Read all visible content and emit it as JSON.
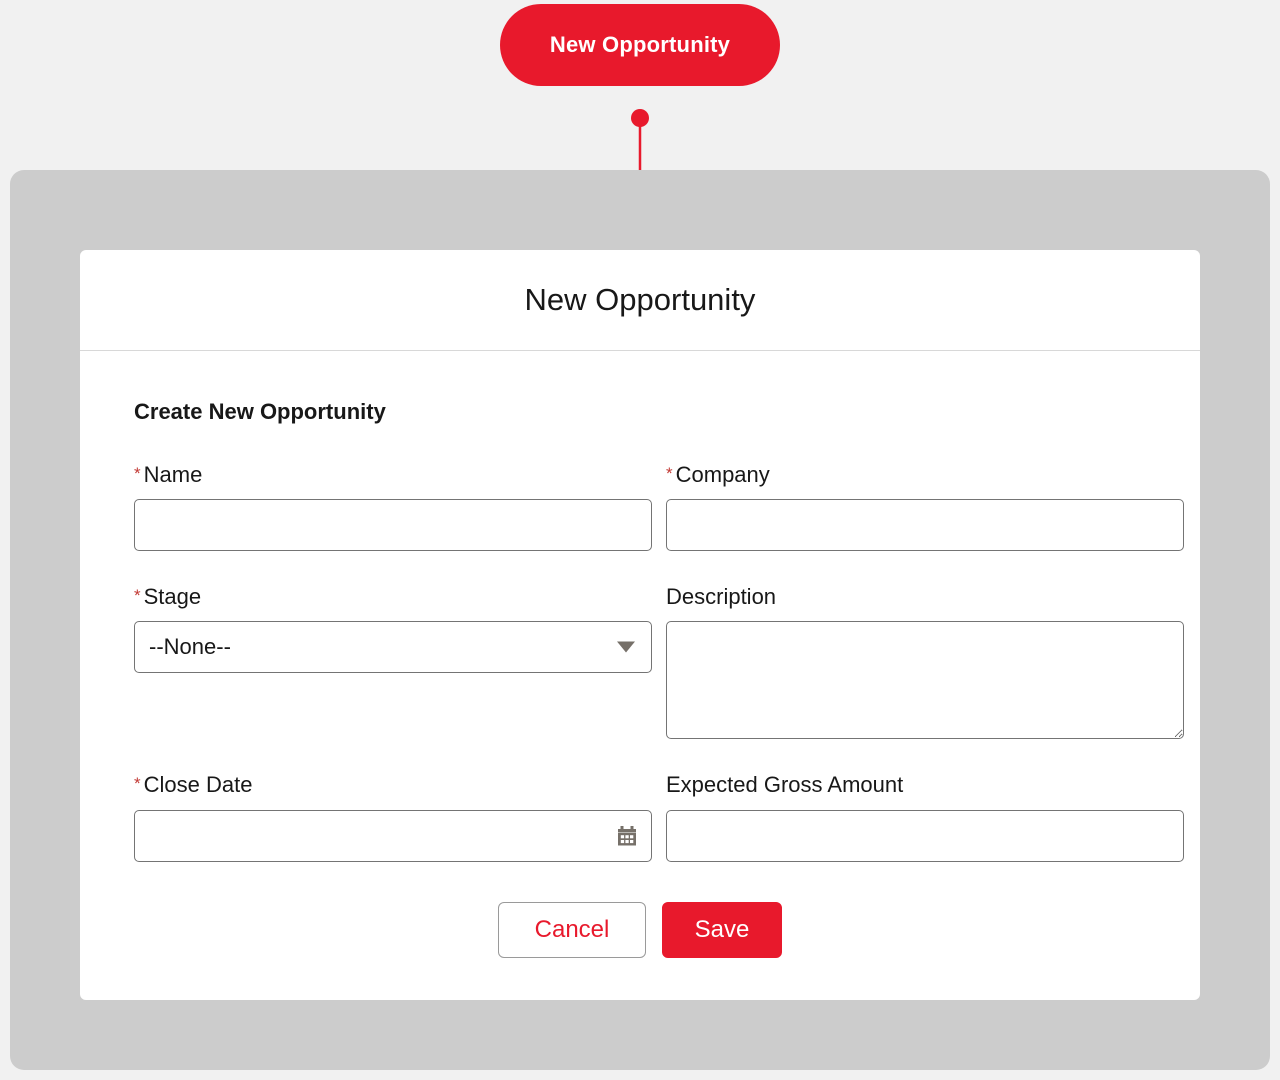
{
  "annotation": {
    "badge_label": "New Opportunity",
    "badge_color": "#E8192C",
    "arrow_color": "#E8192C",
    "arrow_icon": "down-arrow-pointer"
  },
  "modal": {
    "title": "New Opportunity",
    "section_heading": "Create New Opportunity",
    "fields": {
      "name": {
        "label": "Name",
        "required": true,
        "required_marker": "*",
        "value": "",
        "placeholder": ""
      },
      "company": {
        "label": "Company",
        "required": true,
        "required_marker": "*",
        "value": "",
        "placeholder": ""
      },
      "stage": {
        "label": "Stage",
        "required": true,
        "required_marker": "*",
        "value": "--None--",
        "caret_icon": "chevron-down-icon"
      },
      "description": {
        "label": "Description",
        "required": false,
        "value": "",
        "placeholder": ""
      },
      "close_date": {
        "label": "Close Date",
        "required": true,
        "required_marker": "*",
        "value": "",
        "placeholder": "",
        "trailing_icon": "calendar-icon"
      },
      "expected_gross_amount": {
        "label": "Expected Gross Amount",
        "required": false,
        "value": "",
        "placeholder": ""
      }
    },
    "actions": {
      "cancel_label": "Cancel",
      "save_label": "Save"
    }
  },
  "colors": {
    "accent_red": "#E8192C",
    "required_star": "#c23934",
    "page_background": "#f1f1f1",
    "panel_background": "#cccccc",
    "modal_background": "#ffffff",
    "input_border": "#747474"
  }
}
